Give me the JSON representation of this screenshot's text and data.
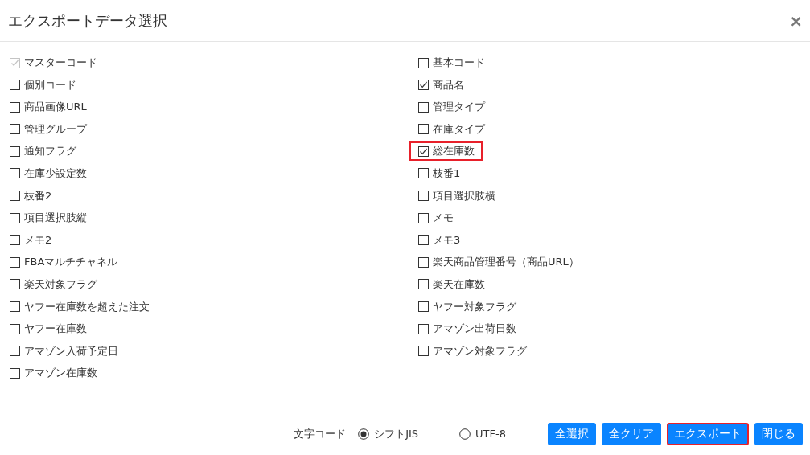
{
  "dialog": {
    "title": "エクスポートデータ選択",
    "close": "×"
  },
  "columns": [
    {
      "items": [
        {
          "label": "マスターコード",
          "checked": true,
          "disabled": true,
          "highlighted": false
        },
        {
          "label": "個別コード",
          "checked": false,
          "disabled": false,
          "highlighted": false
        },
        {
          "label": "商品画像URL",
          "checked": false,
          "disabled": false,
          "highlighted": false
        },
        {
          "label": "管理グループ",
          "checked": false,
          "disabled": false,
          "highlighted": false
        },
        {
          "label": "通知フラグ",
          "checked": false,
          "disabled": false,
          "highlighted": false
        },
        {
          "label": "在庫少設定数",
          "checked": false,
          "disabled": false,
          "highlighted": false
        },
        {
          "label": "枝番2",
          "checked": false,
          "disabled": false,
          "highlighted": false
        },
        {
          "label": "項目選択肢縦",
          "checked": false,
          "disabled": false,
          "highlighted": false
        },
        {
          "label": "メモ2",
          "checked": false,
          "disabled": false,
          "highlighted": false
        },
        {
          "label": "FBAマルチチャネル",
          "checked": false,
          "disabled": false,
          "highlighted": false
        },
        {
          "label": "楽天対象フラグ",
          "checked": false,
          "disabled": false,
          "highlighted": false
        },
        {
          "label": "ヤフー在庫数を超えた注文",
          "checked": false,
          "disabled": false,
          "highlighted": false
        },
        {
          "label": "ヤフー在庫数",
          "checked": false,
          "disabled": false,
          "highlighted": false
        },
        {
          "label": "アマゾン入荷予定日",
          "checked": false,
          "disabled": false,
          "highlighted": false
        },
        {
          "label": "アマゾン在庫数",
          "checked": false,
          "disabled": false,
          "highlighted": false
        }
      ]
    },
    {
      "items": [
        {
          "label": "基本コード",
          "checked": false,
          "disabled": false,
          "highlighted": false
        },
        {
          "label": "商品名",
          "checked": true,
          "disabled": false,
          "highlighted": false
        },
        {
          "label": "管理タイプ",
          "checked": false,
          "disabled": false,
          "highlighted": false
        },
        {
          "label": "在庫タイプ",
          "checked": false,
          "disabled": false,
          "highlighted": false
        },
        {
          "label": "総在庫数",
          "checked": true,
          "disabled": false,
          "highlighted": true
        },
        {
          "label": "枝番1",
          "checked": false,
          "disabled": false,
          "highlighted": false
        },
        {
          "label": "項目選択肢横",
          "checked": false,
          "disabled": false,
          "highlighted": false
        },
        {
          "label": "メモ",
          "checked": false,
          "disabled": false,
          "highlighted": false
        },
        {
          "label": "メモ3",
          "checked": false,
          "disabled": false,
          "highlighted": false
        },
        {
          "label": "楽天商品管理番号（商品URL）",
          "checked": false,
          "disabled": false,
          "highlighted": false
        },
        {
          "label": "楽天在庫数",
          "checked": false,
          "disabled": false,
          "highlighted": false
        },
        {
          "label": "ヤフー対象フラグ",
          "checked": false,
          "disabled": false,
          "highlighted": false
        },
        {
          "label": "アマゾン出荷日数",
          "checked": false,
          "disabled": false,
          "highlighted": false
        },
        {
          "label": "アマゾン対象フラグ",
          "checked": false,
          "disabled": false,
          "highlighted": false
        }
      ]
    }
  ],
  "footer": {
    "encoding_label": "文字コード",
    "encodings": [
      {
        "label": "シフトJIS",
        "selected": true
      },
      {
        "label": "UTF-8",
        "selected": false
      }
    ],
    "buttons": [
      {
        "label": "全選択",
        "highlighted": false
      },
      {
        "label": "全クリア",
        "highlighted": false
      },
      {
        "label": "エクスポート",
        "highlighted": true
      },
      {
        "label": "閉じる",
        "highlighted": false
      }
    ]
  }
}
